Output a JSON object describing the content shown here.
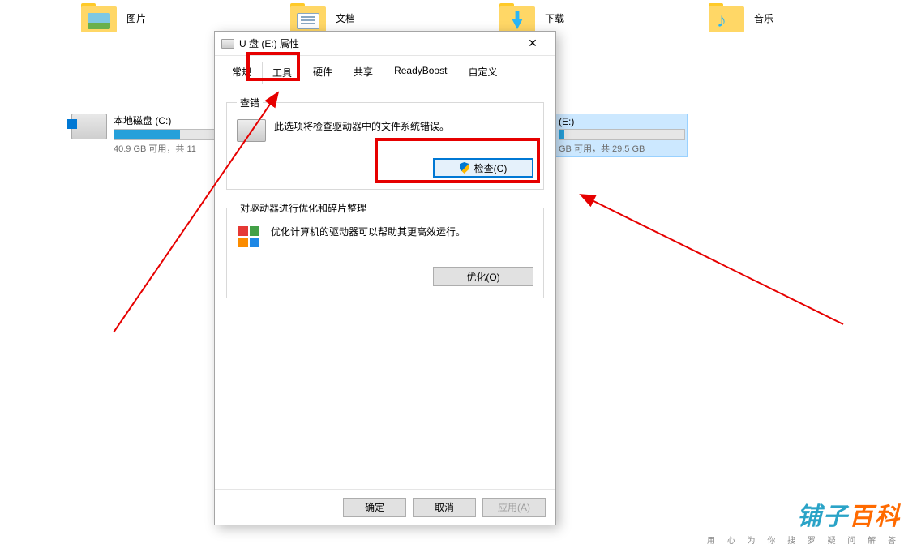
{
  "folders": [
    {
      "label": "图片",
      "kind": "pic"
    },
    {
      "label": "文档",
      "kind": "doc"
    },
    {
      "label": "下载",
      "kind": "down"
    },
    {
      "label": "音乐",
      "kind": "music"
    }
  ],
  "drives": {
    "c": {
      "name": "本地磁盘 (C:)",
      "usage": "40.9 GB 可用，共 11",
      "fill_pct": 64
    },
    "e": {
      "name": "(E:)",
      "usage": "GB 可用，共 29.5 GB",
      "fill_pct": 4
    }
  },
  "dialog": {
    "title": "U 盘 (E:) 属性",
    "tabs": [
      "常规",
      "工具",
      "硬件",
      "共享",
      "ReadyBoost",
      "自定义"
    ],
    "active_tab": "工具",
    "error_check": {
      "legend": "查错",
      "desc": "此选项将检查驱动器中的文件系统错误。",
      "button": "检查(C)"
    },
    "optimize": {
      "legend": "对驱动器进行优化和碎片整理",
      "desc": "优化计算机的驱动器可以帮助其更高效运行。",
      "button": "优化(O)"
    },
    "footer": {
      "ok": "确定",
      "cancel": "取消",
      "apply": "应用(A)"
    }
  },
  "watermark": {
    "brand_main": "铺子",
    "brand_accent": "百科",
    "tagline": "用 心 为 你 搜 罗 疑 问 解 答"
  }
}
